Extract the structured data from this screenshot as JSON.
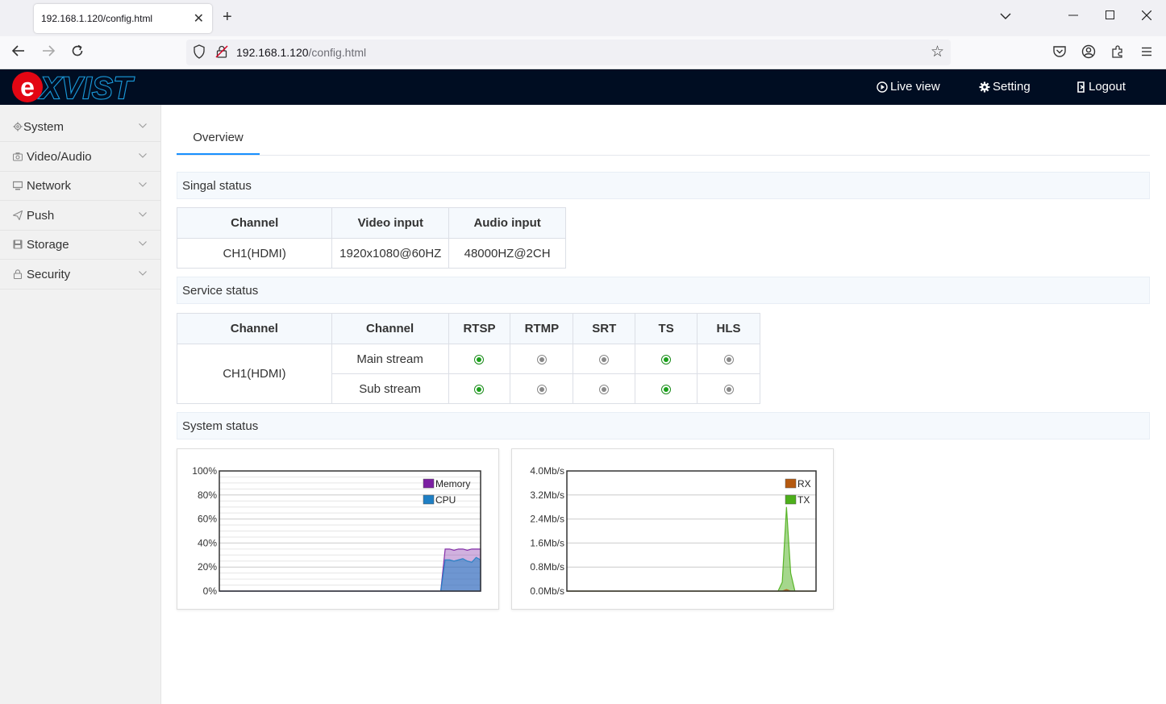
{
  "browser": {
    "tab_title": "192.168.1.120/config.html",
    "url_host": "192.168.1.120",
    "url_path": "/config.html"
  },
  "header": {
    "logo_text": "eXVIST",
    "nav": [
      {
        "label": "Live view",
        "icon": "play-circle-icon"
      },
      {
        "label": "Setting",
        "icon": "gear-icon"
      },
      {
        "label": "Logout",
        "icon": "logout-icon"
      }
    ]
  },
  "sidebar": {
    "items": [
      {
        "label": "System",
        "icon": "gear-icon"
      },
      {
        "label": "Video/Audio",
        "icon": "camera-icon"
      },
      {
        "label": "Network",
        "icon": "monitor-icon"
      },
      {
        "label": "Push",
        "icon": "send-icon"
      },
      {
        "label": "Storage",
        "icon": "disk-icon"
      },
      {
        "label": "Security",
        "icon": "lock-icon"
      }
    ]
  },
  "main": {
    "tab": "Overview",
    "signal_title": "Singal status",
    "signal": {
      "headers": [
        "Channel",
        "Video input",
        "Audio input"
      ],
      "rows": [
        [
          "CH1(HDMI)",
          "1920x1080@60HZ",
          "48000HZ@2CH"
        ]
      ]
    },
    "service_title": "Service status",
    "service": {
      "headers": [
        "Channel",
        "Channel",
        "RTSP",
        "RTMP",
        "SRT",
        "TS",
        "HLS"
      ],
      "channel": "CH1(HDMI)",
      "rows": [
        {
          "stream": "Main stream",
          "states": [
            true,
            false,
            false,
            true,
            false
          ]
        },
        {
          "stream": "Sub stream",
          "states": [
            true,
            false,
            false,
            true,
            false
          ]
        }
      ]
    },
    "system_title": "System status"
  },
  "colors": {
    "accent": "#1890ff",
    "header_bg": "#000d22",
    "memory": "#7b1fa2",
    "cpu": "#1e7fc4",
    "rx": "#b5590f",
    "tx": "#4caf1a"
  },
  "chart_data": [
    {
      "type": "area",
      "title": "",
      "yticks": [
        "100%",
        "80%",
        "60%",
        "40%",
        "20%",
        "0%"
      ],
      "ylim": [
        0,
        100
      ],
      "legend": "top-right",
      "x": [
        0,
        1,
        2,
        3,
        4,
        5,
        6,
        7,
        8,
        9,
        10,
        11,
        12,
        13,
        14,
        15,
        16,
        17,
        18,
        19,
        20,
        21,
        22,
        23,
        24,
        25,
        26,
        27,
        28,
        29,
        30,
        31,
        32,
        33,
        34,
        35,
        36,
        37,
        38,
        39,
        40,
        41,
        42,
        43,
        44,
        45,
        46,
        47,
        48,
        49,
        50,
        51,
        52,
        53,
        54,
        55,
        56,
        57,
        58,
        59
      ],
      "series": [
        {
          "name": "Memory",
          "values": [
            0,
            0,
            0,
            0,
            0,
            0,
            0,
            0,
            0,
            0,
            0,
            0,
            0,
            0,
            0,
            0,
            0,
            0,
            0,
            0,
            0,
            0,
            0,
            0,
            0,
            0,
            0,
            0,
            0,
            0,
            0,
            0,
            0,
            0,
            0,
            0,
            0,
            0,
            0,
            0,
            0,
            0,
            0,
            0,
            0,
            0,
            0,
            0,
            0,
            0,
            0,
            35,
            35,
            34,
            35,
            35,
            34,
            35,
            35,
            35
          ]
        },
        {
          "name": "CPU",
          "values": [
            0,
            0,
            0,
            0,
            0,
            0,
            0,
            0,
            0,
            0,
            0,
            0,
            0,
            0,
            0,
            0,
            0,
            0,
            0,
            0,
            0,
            0,
            0,
            0,
            0,
            0,
            0,
            0,
            0,
            0,
            0,
            0,
            0,
            0,
            0,
            0,
            0,
            0,
            0,
            0,
            0,
            0,
            0,
            0,
            0,
            0,
            0,
            0,
            0,
            0,
            0,
            26,
            26,
            25,
            26,
            27,
            25,
            24,
            28,
            26
          ]
        }
      ]
    },
    {
      "type": "area",
      "title": "",
      "yticks": [
        "4.0Mb/s",
        "3.2Mb/s",
        "2.4Mb/s",
        "1.6Mb/s",
        "0.8Mb/s",
        "0.0Mb/s"
      ],
      "ylim": [
        0,
        4.0
      ],
      "legend": "top-right",
      "x": [
        0,
        1,
        2,
        3,
        4,
        5,
        6,
        7,
        8,
        9,
        10,
        11,
        12,
        13,
        14,
        15,
        16,
        17,
        18,
        19,
        20,
        21,
        22,
        23,
        24,
        25,
        26,
        27,
        28,
        29,
        30,
        31,
        32,
        33,
        34,
        35,
        36,
        37,
        38,
        39,
        40,
        41,
        42,
        43,
        44,
        45,
        46,
        47,
        48,
        49,
        50,
        51,
        52,
        53,
        54,
        55,
        56,
        57,
        58,
        59
      ],
      "series": [
        {
          "name": "RX",
          "values": [
            0,
            0,
            0,
            0,
            0,
            0,
            0,
            0,
            0,
            0,
            0,
            0,
            0,
            0,
            0,
            0,
            0,
            0,
            0,
            0,
            0,
            0,
            0,
            0,
            0,
            0,
            0,
            0,
            0,
            0,
            0,
            0,
            0,
            0,
            0,
            0,
            0,
            0,
            0,
            0,
            0,
            0,
            0,
            0,
            0,
            0,
            0,
            0,
            0,
            0,
            0,
            0,
            0.05,
            0,
            0,
            0,
            0,
            0,
            0,
            0
          ]
        },
        {
          "name": "TX",
          "values": [
            0,
            0,
            0,
            0,
            0,
            0,
            0,
            0,
            0,
            0,
            0,
            0,
            0,
            0,
            0,
            0,
            0,
            0,
            0,
            0,
            0,
            0,
            0,
            0,
            0,
            0,
            0,
            0,
            0,
            0,
            0,
            0,
            0,
            0,
            0,
            0,
            0,
            0,
            0,
            0,
            0,
            0,
            0,
            0,
            0,
            0,
            0,
            0,
            0,
            0,
            0,
            0.3,
            2.8,
            0.6,
            0,
            0,
            0,
            0,
            0,
            0
          ]
        }
      ]
    }
  ]
}
